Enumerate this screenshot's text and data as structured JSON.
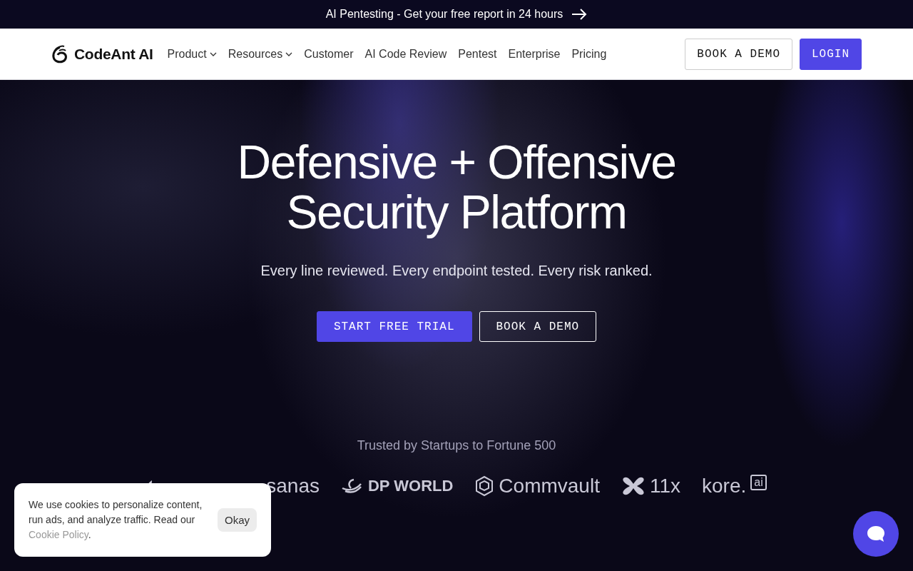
{
  "announcement": {
    "text": "AI Pentesting - Get your free report in 24 hours"
  },
  "nav": {
    "brand": "CodeAnt AI",
    "items": [
      {
        "label": "Product",
        "dropdown": true
      },
      {
        "label": "Resources",
        "dropdown": true
      },
      {
        "label": "Customer",
        "dropdown": false
      },
      {
        "label": "AI Code Review",
        "dropdown": false
      },
      {
        "label": "Pentest",
        "dropdown": false
      },
      {
        "label": "Enterprise",
        "dropdown": false
      },
      {
        "label": "Pricing",
        "dropdown": false
      }
    ],
    "demo_button": "BOOK A DEMO",
    "login_button": "LOGIN"
  },
  "hero": {
    "title_lines": [
      "Defensive + Offensive",
      "Security Platform"
    ],
    "subtitle": "Every line reviewed. Every endpoint tested. Every risk ranked.",
    "primary_button": "START FREE TRIAL",
    "secondary_button": "BOOK A DEMO"
  },
  "trusted": {
    "caption": "Trusted by Startups to Fortune 500",
    "logos": [
      {
        "kind": "hidden"
      },
      {
        "kind": "sanas",
        "text": "sanas"
      },
      {
        "kind": "dpworld",
        "text": "DP WORLD"
      },
      {
        "kind": "commvault",
        "text": "Commvault"
      },
      {
        "kind": "elevenx",
        "text": "11x"
      },
      {
        "kind": "kore",
        "text": "kore.",
        "tag": "ai"
      }
    ]
  },
  "cookie_banner": {
    "text": "We use cookies to personalize content, run ads, and analyze traffic. Read our ",
    "link": "Cookie Policy",
    "end": ".",
    "button": "Okay"
  }
}
